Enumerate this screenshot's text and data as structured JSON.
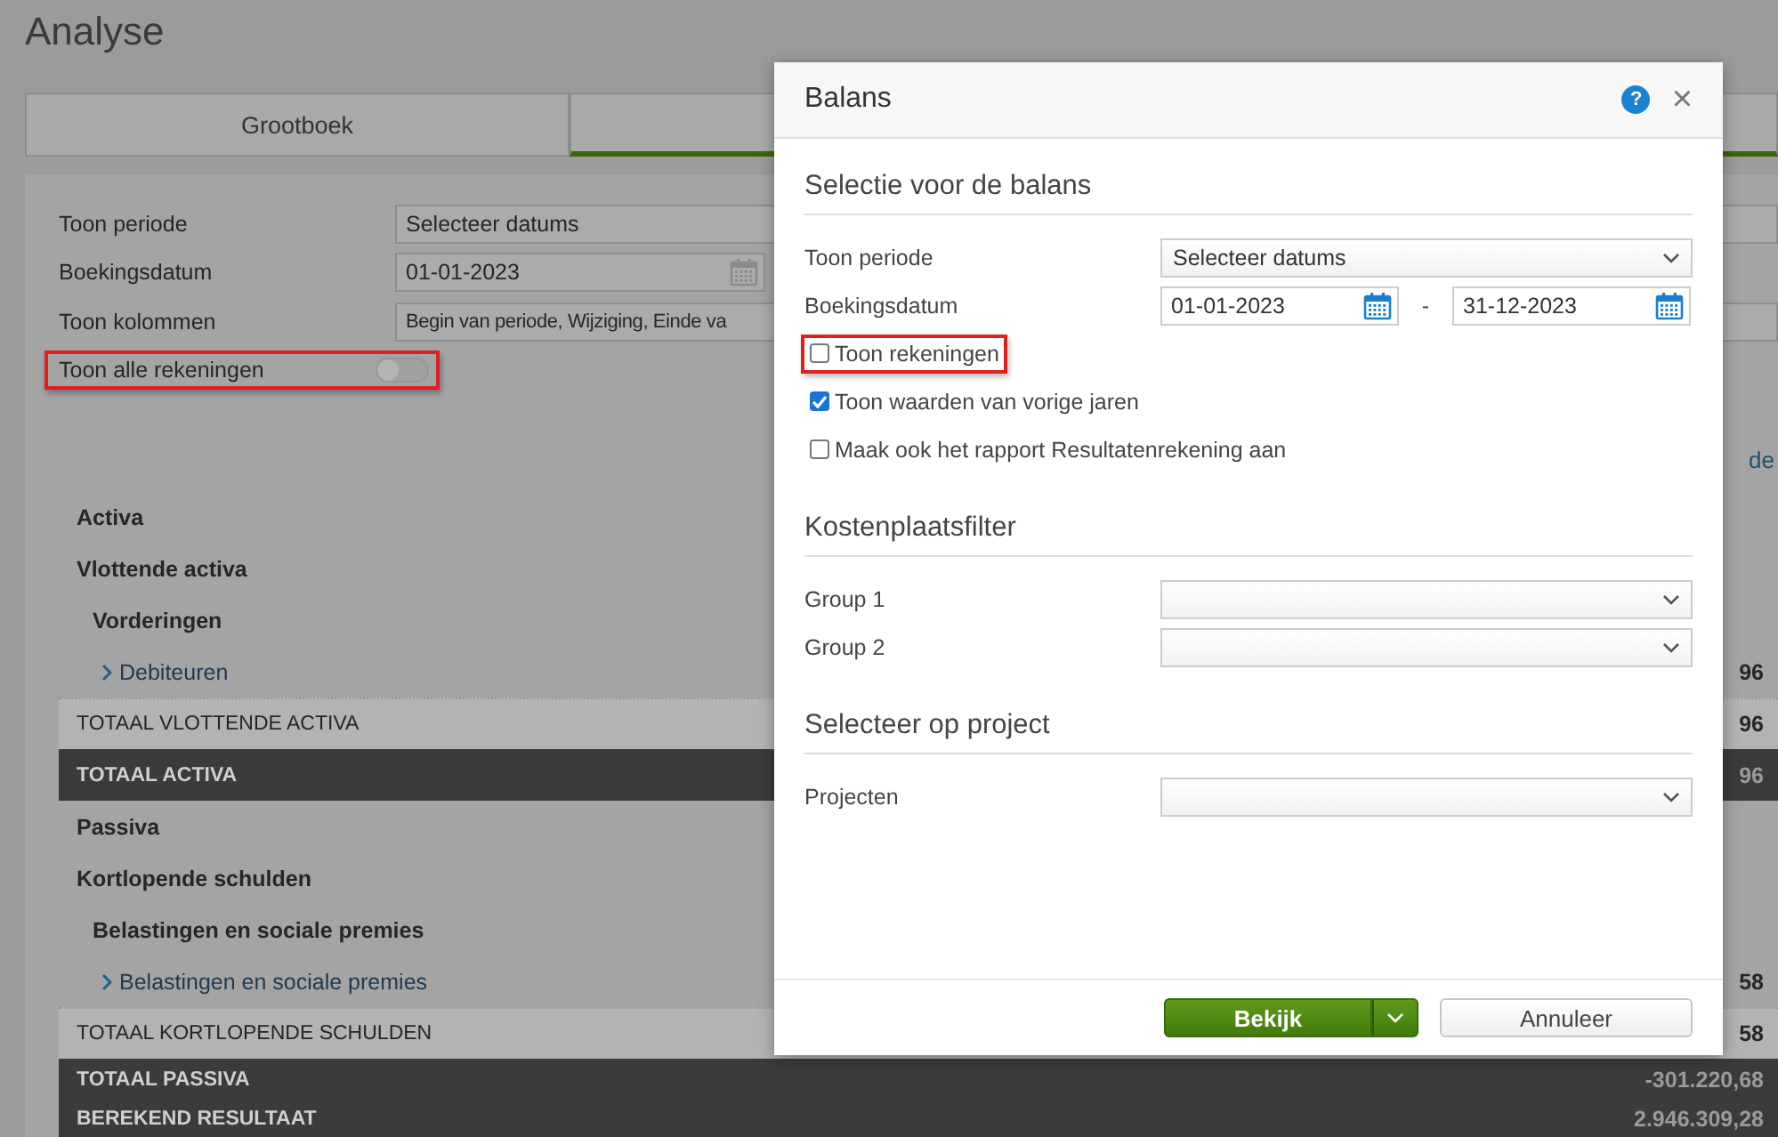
{
  "page": {
    "title": "Analyse"
  },
  "tabs": [
    {
      "label": "Grootboek",
      "selected": false
    },
    {
      "selected": true
    }
  ],
  "filters": [
    {
      "kind": "select",
      "label": "Toon periode",
      "value": "Selecteer datums"
    },
    {
      "kind": "date",
      "label": "Boekingsdatum",
      "value": "01-01-2023"
    },
    {
      "kind": "select",
      "label": "Toon kolommen",
      "value": "Begin van periode, Wijziging, Einde va"
    },
    {
      "kind": "toggle",
      "label": "Toon alle rekeningen",
      "on": false,
      "highlighted": true
    }
  ],
  "side_link": "de",
  "report_rows": [
    {
      "kind": "heading",
      "label": "Activa"
    },
    {
      "kind": "heading",
      "label": "Vlottende activa"
    },
    {
      "kind": "subheading",
      "label": "Vorderingen"
    },
    {
      "kind": "account",
      "label": "Debiteuren",
      "value": "96"
    },
    {
      "kind": "subtotal",
      "label": "TOTAAL VLOTTENDE ACTIVA",
      "value": "96"
    },
    {
      "kind": "total",
      "label": "TOTAAL ACTIVA",
      "value": "96"
    },
    {
      "kind": "heading",
      "label": "Passiva"
    },
    {
      "kind": "heading",
      "label": "Kortlopende schulden"
    },
    {
      "kind": "subheading",
      "label": "Belastingen en sociale premies"
    },
    {
      "kind": "account",
      "label": "Belastingen en sociale premies",
      "value": "58"
    },
    {
      "kind": "subtotal",
      "label": "TOTAAL KORTLOPENDE SCHULDEN",
      "value": "58"
    },
    {
      "kind": "total",
      "label": "TOTAAL PASSIVA",
      "value": "-301.220,68"
    },
    {
      "kind": "total",
      "label": "BEREKEND RESULTAAT",
      "value": "2.946.309,28"
    }
  ],
  "dialog": {
    "title": "Balans",
    "help": "?",
    "close": "×",
    "sections": [
      {
        "title": "Selectie voor de balans",
        "fields": [
          {
            "kind": "select",
            "label": "Toon periode",
            "value": "Selecteer datums"
          },
          {
            "kind": "date_range",
            "label": "Boekingsdatum",
            "from": "01-01-2023",
            "separator": "-",
            "to": "31-12-2023"
          },
          {
            "kind": "checkbox",
            "label": "Toon rekeningen",
            "checked": false,
            "highlighted": true
          },
          {
            "kind": "checkbox",
            "label": "Toon waarden van vorige jaren",
            "checked": true,
            "highlighted": false
          },
          {
            "kind": "checkbox",
            "label": "Maak ook het rapport Resultatenrekening aan",
            "checked": false,
            "highlighted": false
          }
        ]
      },
      {
        "title": "Kostenplaatsfilter",
        "fields": [
          {
            "kind": "select",
            "label": "Group 1"
          },
          {
            "kind": "select",
            "label": "Group 2"
          }
        ]
      },
      {
        "title": "Selecteer op project",
        "fields": [
          {
            "kind": "select",
            "label": "Projecten"
          }
        ]
      }
    ],
    "buttons": [
      {
        "kind": "primary",
        "label": "Bekijk"
      },
      {
        "kind": "secondary",
        "label": "Annuleer"
      }
    ]
  }
}
